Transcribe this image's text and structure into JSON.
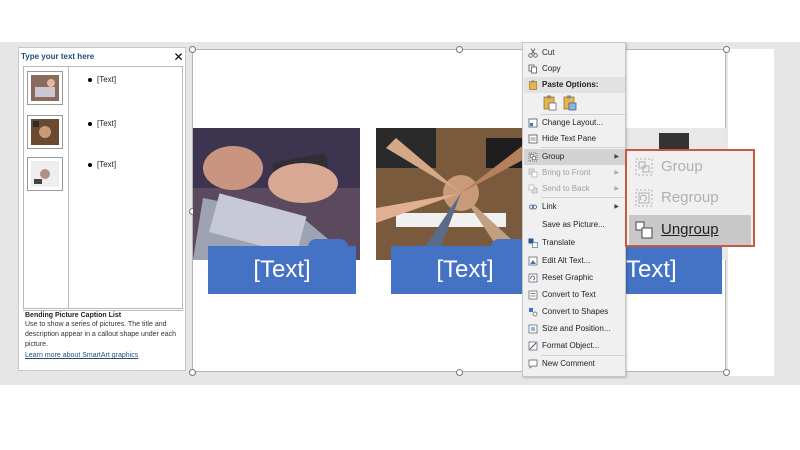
{
  "text_pane": {
    "title": "Type your text here",
    "close_glyph": "✕",
    "items": [
      "[Text]",
      "[Text]",
      "[Text]"
    ],
    "description_title": "Bending Picture Caption List",
    "description_body": "Use to show a series of pictures. The title and description appear in a callout shape under each picture.",
    "learn_more": "Learn more about SmartArt graphics"
  },
  "smartart": {
    "captions": [
      "[Text]",
      "[Text]",
      "[Text]"
    ],
    "caption_color": "#4472c4"
  },
  "context_menu": {
    "cut": "Cut",
    "copy": "Copy",
    "paste_options": "Paste Options:",
    "change_layout": "Change Layout...",
    "hide_text_pane": "Hide Text Pane",
    "group": "Group",
    "bring_to_front": "Bring to Front",
    "send_to_back": "Send to Back",
    "link": "Link",
    "save_as_picture": "Save as Picture...",
    "translate": "Translate",
    "edit_alt_text": "Edit Alt Text...",
    "reset_graphic": "Reset Graphic",
    "convert_to_text": "Convert to Text",
    "convert_to_shapes": "Convert to Shapes",
    "size_and_position": "Size and Position...",
    "format_object": "Format Object...",
    "new_comment": "New Comment"
  },
  "group_submenu": {
    "group": "Group",
    "regroup": "Regroup",
    "ungroup": "Ungroup",
    "border_color": "#c55a3f"
  }
}
